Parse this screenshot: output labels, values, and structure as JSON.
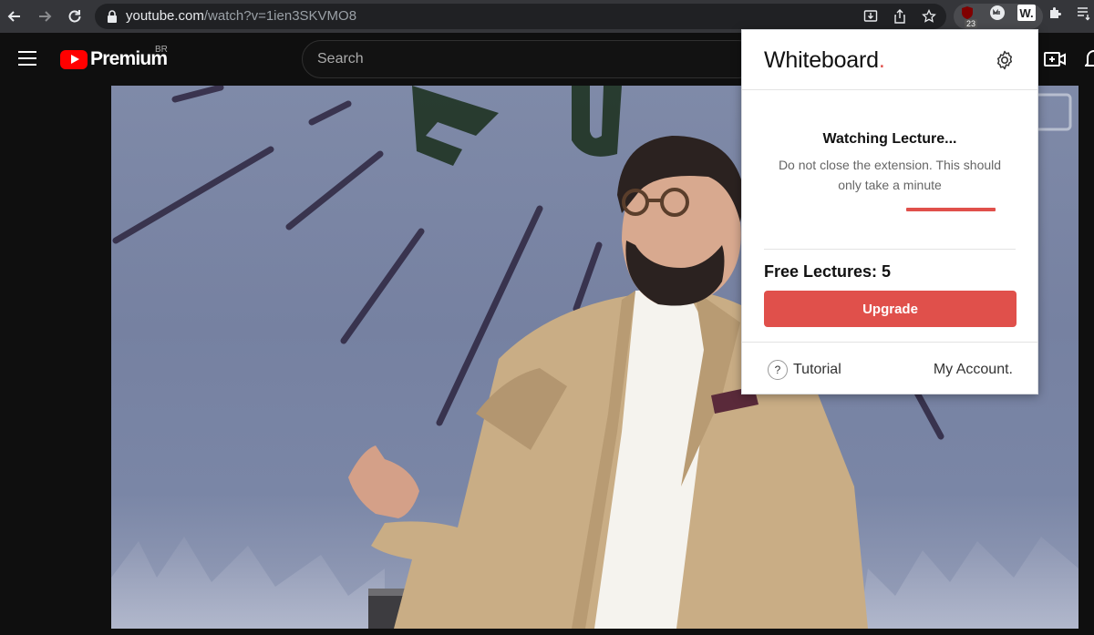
{
  "browser": {
    "url_domain": "youtube.com",
    "url_path": "/watch?v=1ien3SKVMO8",
    "ublock_count": "23",
    "toolbar_icons": [
      "back-icon",
      "forward-icon",
      "reload-icon",
      "lock-icon",
      "install-icon",
      "share-icon",
      "star-icon",
      "ublock-icon",
      "extension-icon",
      "whiteboard-extension-icon",
      "puzzle-icon",
      "reading-list-icon"
    ],
    "whiteboard_ext_label": "W."
  },
  "youtube": {
    "logo_text": "Premium",
    "country_code": "BR",
    "search_placeholder": "Search"
  },
  "popup": {
    "brand": "Whiteboard",
    "brand_dot": ".",
    "status_title": "Watching Lecture...",
    "status_subtitle": "Do not close the extension. This should only take a minute",
    "free_lectures_label": "Free Lectures: 5",
    "upgrade_label": "Upgrade",
    "tutorial_icon_text": "?",
    "tutorial_label": "Tutorial",
    "account_label": "My Account.",
    "accent_color": "#e0504b"
  }
}
